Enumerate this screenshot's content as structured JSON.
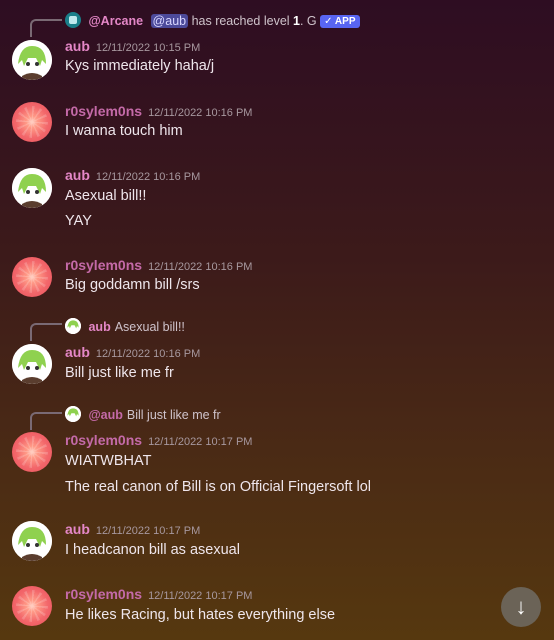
{
  "messages": [
    {
      "author": "aub",
      "avatar": "aub",
      "timestamp": "12/11/2022 10:15 PM",
      "lines": [
        "Kys immediately haha/j"
      ],
      "reply": {
        "bot_name": "@Arcane",
        "mention": "@aub",
        "text": " has reached level ",
        "level": "1",
        "tail": ". G",
        "badge": "✓ APP"
      }
    },
    {
      "author": "r0sylem0ns",
      "avatar": "grape",
      "timestamp": "12/11/2022 10:16 PM",
      "lines": [
        "I wanna touch him"
      ]
    },
    {
      "author": "aub",
      "avatar": "aub",
      "timestamp": "12/11/2022 10:16 PM",
      "lines": [
        "Asexual bill!!",
        "YAY"
      ]
    },
    {
      "author": "r0sylem0ns",
      "avatar": "grape",
      "timestamp": "12/11/2022 10:16 PM",
      "lines": [
        "Big goddamn bill /srs"
      ]
    },
    {
      "author": "aub",
      "avatar": "aub",
      "timestamp": "12/11/2022 10:16 PM",
      "lines": [
        "Bill just like me fr"
      ],
      "reply": {
        "name": "aub",
        "text": "Asexual bill!!"
      }
    },
    {
      "author": "r0sylem0ns",
      "avatar": "grape",
      "timestamp": "12/11/2022 10:17 PM",
      "lines": [
        "WIATWBHAT",
        "The real canon of Bill is on Official Fingersoft lol"
      ],
      "reply": {
        "name": "@aub",
        "text": "Bill just like me fr"
      }
    },
    {
      "author": "aub",
      "avatar": "aub",
      "timestamp": "12/11/2022 10:17 PM",
      "lines": [
        "I headcanon bill as asexual"
      ]
    },
    {
      "author": "r0sylem0ns",
      "avatar": "grape",
      "timestamp": "12/11/2022 10:17 PM",
      "lines": [
        "He likes Racing, but hates everything else"
      ]
    }
  ],
  "scroll_button": {
    "icon": "arrow-down-icon",
    "glyph": "↓"
  }
}
